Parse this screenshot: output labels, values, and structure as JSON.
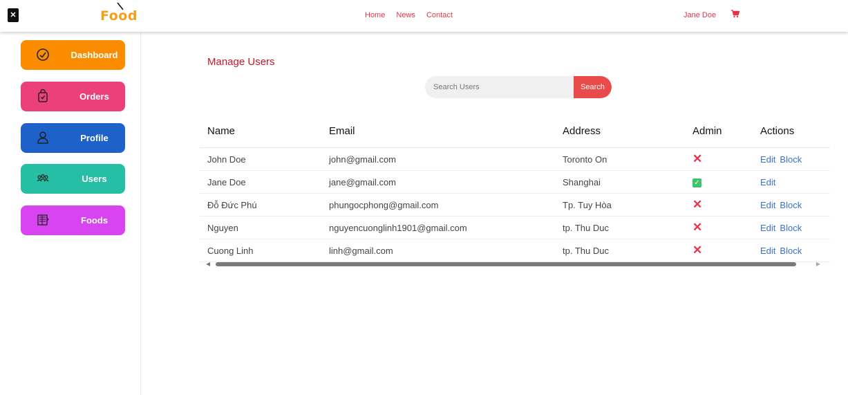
{
  "app": {
    "logo_text": "Food"
  },
  "nav": {
    "items": [
      "Home",
      "News",
      "Contact"
    ],
    "user_name": "Jane Doe"
  },
  "sidebar": {
    "items": [
      {
        "label": "Dashboard",
        "color": "#fb8c00",
        "icon": "speedometer-icon"
      },
      {
        "label": "Orders",
        "color": "#ec407a",
        "icon": "shopping-bag-icon"
      },
      {
        "label": "Profile",
        "color": "#1e62c9",
        "icon": "user-icon"
      },
      {
        "label": "Users",
        "color": "#26bfa6",
        "icon": "users-group-icon"
      },
      {
        "label": "Foods",
        "color": "#d844f0",
        "icon": "food-icon"
      }
    ]
  },
  "main": {
    "title": "Manage Users",
    "search": {
      "placeholder": "Search Users",
      "button_label": "Search"
    },
    "table": {
      "headers": [
        "Name",
        "Email",
        "Address",
        "Admin",
        "Actions"
      ],
      "rows": [
        {
          "name": "John Doe",
          "email": "john@gmail.com",
          "address": "Toronto On",
          "admin": false,
          "edit": "Edit",
          "block": "Block"
        },
        {
          "name": "Jane Doe",
          "email": "jane@gmail.com",
          "address": "Shanghai",
          "admin": true,
          "edit": "Edit",
          "block": ""
        },
        {
          "name": "Đỗ Đức Phú",
          "email": "phungocphong@gmail.com",
          "address": "Tp. Tuy Hòa",
          "admin": false,
          "edit": "Edit",
          "block": "Block"
        },
        {
          "name": "Nguyen",
          "email": "nguyencuonglinh1901@gmail.com",
          "address": "tp. Thu Duc",
          "admin": false,
          "edit": "Edit",
          "block": "Block"
        },
        {
          "name": "Cuong Linh",
          "email": "linh@gmail.com",
          "address": "tp. Thu Duc",
          "admin": false,
          "edit": "Edit",
          "block": "Block"
        }
      ]
    }
  },
  "colors": {
    "accent_red": "#e2344a",
    "search_button": "#e94b4b",
    "link_blue": "#3a72c9",
    "admin_yes": "#3ec46d"
  }
}
